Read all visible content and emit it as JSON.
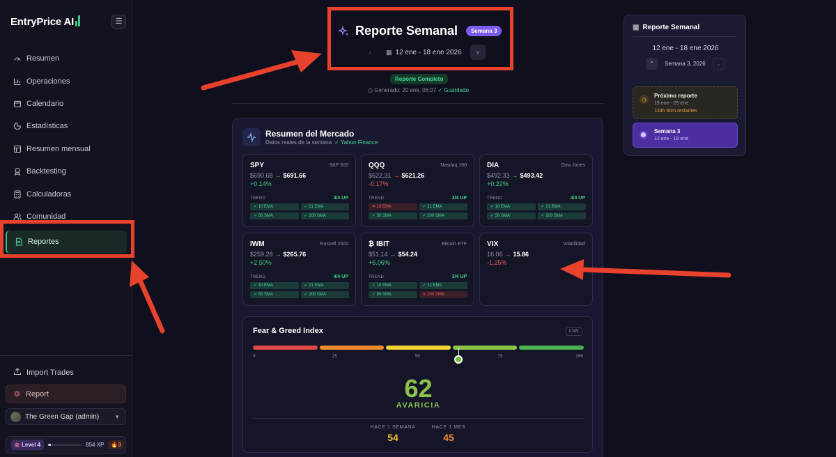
{
  "sidebar": {
    "logo": "EntryPrice AI",
    "nav": [
      {
        "label": "Resumen",
        "icon": "gauge-icon"
      },
      {
        "label": "Operaciones",
        "icon": "bar-chart-icon"
      },
      {
        "label": "Calendario",
        "icon": "calendar-icon"
      },
      {
        "label": "Estadísticas",
        "icon": "pie-chart-icon"
      },
      {
        "label": "Resumen mensual",
        "icon": "table-icon"
      },
      {
        "label": "Backtesting",
        "icon": "award-icon"
      },
      {
        "label": "Calculadoras",
        "icon": "calculator-icon"
      },
      {
        "label": "Comunidad",
        "icon": "users-icon"
      },
      {
        "label": "Reportes",
        "icon": "document-icon",
        "active": true
      }
    ],
    "import_label": "Import Trades",
    "report_label": "Report",
    "user_name": "The Green Gap (admin)",
    "level_label": "Level 4",
    "xp": "854 XP",
    "xp_progress": 0.08,
    "streak": "3"
  },
  "header": {
    "title": "Reporte Semanal",
    "week_badge": "Semana 3",
    "date_range": "12 ene - 18 ene 2026",
    "status_badge": "Reporte Completo",
    "generated": "Generado: 20 ene, 06:07",
    "saved": "✓ Guardado"
  },
  "market": {
    "title": "Resumen del Mercado",
    "subtitle": "Datos reales de la semana",
    "source": "✓ Yahoo Finance",
    "trend_label": "TREND",
    "cards": [
      {
        "symbol": "SPY",
        "index": "S&P 500",
        "prev": "$690.68",
        "curr": "$691.66",
        "change": "+0.14%",
        "dir": "up",
        "trend": "4/4 UP",
        "chips": [
          [
            "10 EMA",
            true
          ],
          [
            "21 EMA",
            true
          ],
          [
            "50 SMA",
            true
          ],
          [
            "200 SMA",
            true
          ]
        ]
      },
      {
        "symbol": "QQQ",
        "index": "Nasdaq 100",
        "prev": "$622.31",
        "curr": "$621.26",
        "change": "-0.17%",
        "dir": "dn",
        "trend": "3/4 UP",
        "chips": [
          [
            "10 EMA",
            false
          ],
          [
            "21 EMA",
            true
          ],
          [
            "50 SMA",
            true
          ],
          [
            "200 SMA",
            true
          ]
        ]
      },
      {
        "symbol": "DIA",
        "index": "Dow Jones",
        "prev": "$492.33",
        "curr": "$493.42",
        "change": "+0.22%",
        "dir": "up",
        "trend": "4/4 UP",
        "chips": [
          [
            "10 EMA",
            true
          ],
          [
            "21 EMA",
            true
          ],
          [
            "50 SMA",
            true
          ],
          [
            "200 SMA",
            true
          ]
        ]
      },
      {
        "symbol": "IWM",
        "index": "Russell 2000",
        "prev": "$259.28",
        "curr": "$265.76",
        "change": "+2.50%",
        "dir": "up",
        "trend": "4/4 UP",
        "chips": [
          [
            "10 EMA",
            true
          ],
          [
            "21 EMA",
            true
          ],
          [
            "50 SMA",
            true
          ],
          [
            "200 SMA",
            true
          ]
        ]
      },
      {
        "symbol": "IBIT",
        "index": "Bitcoin ETF",
        "prev": "$51.14",
        "curr": "$54.24",
        "change": "+6.06%",
        "dir": "up",
        "trend": "3/4 UP",
        "chips": [
          [
            "10 EMA",
            true
          ],
          [
            "21 EMA",
            true
          ],
          [
            "50 SMA",
            true
          ],
          [
            "200 SMA",
            false
          ]
        ]
      },
      {
        "symbol": "VIX",
        "index": "Volatilidad",
        "prev": "16.06",
        "curr": "15.86",
        "change": "-1.25%",
        "dir": "dn"
      }
    ]
  },
  "fear_greed": {
    "title": "Fear & Greed Index",
    "source": "CNN",
    "ticks": [
      "0",
      "25",
      "50",
      "75",
      "100"
    ],
    "value": 62,
    "value_text": "62",
    "label": "AVARICIA",
    "week_label": "HACE 1 SEMANA",
    "week_value": "54",
    "month_label": "HACE 1 MES",
    "month_value": "45",
    "colors": [
      "#e04848",
      "#f08a30",
      "#f2d230",
      "#8bc34a",
      "#4caf50"
    ]
  },
  "panel": {
    "title": "Reporte Semanal",
    "dates": "12 ene - 18 ene 2026",
    "week_nav": "Semana 3, 2026",
    "next_title": "Próximo reporte",
    "next_dates": "19 ene - 25 ene",
    "next_remaining": "133h 50m restantes",
    "current_title": "Semana 3",
    "current_dates": "12 ene - 18 ene"
  },
  "colors": {
    "accent": "#2fbf7f",
    "purple": "#7c5af0",
    "annotation": "#e8412c"
  }
}
